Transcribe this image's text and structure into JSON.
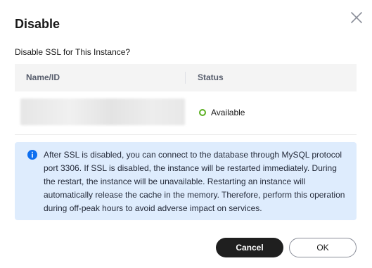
{
  "dialog": {
    "title": "Disable",
    "subtitle": "Disable SSL for This Instance?"
  },
  "table": {
    "columns": [
      "Name/ID",
      "Status"
    ],
    "rows": [
      {
        "name_id": "",
        "status": "Available"
      }
    ]
  },
  "notice": {
    "text": "After SSL is disabled, you can connect to the database through MySQL protocol port 3306. If SSL is disabled, the instance will be restarted immediately. During the restart, the instance will be unavailable. Restarting an instance will automatically release the cache in the memory. Therefore, perform this operation during off-peak hours to avoid adverse impact on services.",
    "icon": "info-icon"
  },
  "buttons": {
    "cancel_label": "Cancel",
    "ok_label": "OK"
  },
  "colors": {
    "status_available": "#5aaf20",
    "notice_bg": "#deecfd",
    "info_icon": "#0d6ff0",
    "primary_button": "#1f1f1f"
  }
}
